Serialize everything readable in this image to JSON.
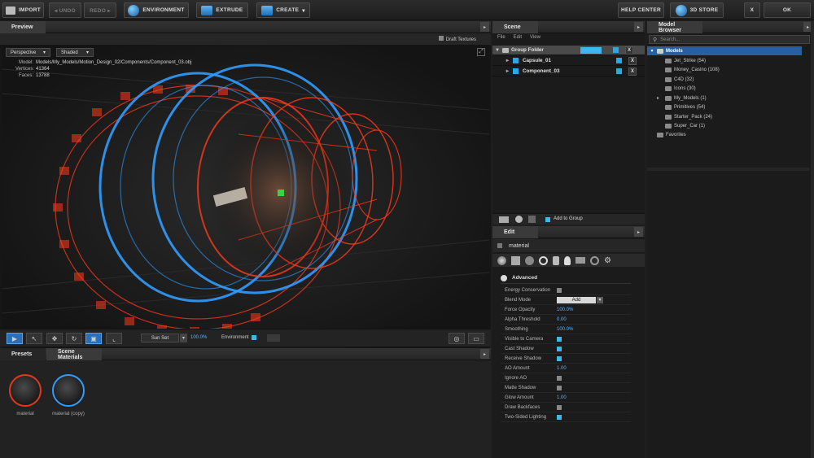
{
  "toolbar": {
    "import": "IMPORT",
    "undo": "◂ UNDO",
    "redo": "REDO ▸",
    "environment": "ENVIRONMENT",
    "extrude": "EXTRUDE",
    "create": "CREATE",
    "create_caret": "▾",
    "help_center": "HELP CENTER",
    "store": "3D STORE",
    "close": "X",
    "ok": "OK"
  },
  "preview": {
    "tab": "Preview",
    "draft_textures": "Draft Textures",
    "camera_mode": "Perspective",
    "render_mode": "Shaded",
    "model_label": "Model:",
    "model_value": "Models/My_Models/Motion_Design_02/Components/Component_03.obj",
    "vertices_label": "Vertices:",
    "vertices_value": "41364",
    "faces_label": "Faces:",
    "faces_value": "13788"
  },
  "viewport_toolbar": {
    "sun_set": "Sun Set",
    "sun_value": "100.0%",
    "environment": "Environment"
  },
  "presets": {
    "tabs": [
      "Presets",
      "Scene Materials"
    ],
    "materials": [
      "material",
      "material (copy)"
    ]
  },
  "scene": {
    "tab": "Scene",
    "menu": [
      "File",
      "Edit",
      "View"
    ],
    "group_folder": "Group Folder",
    "items": [
      "Capsule_01",
      "Component_03"
    ],
    "add_to_group": "Add to Group",
    "close": "X"
  },
  "edit": {
    "tab": "Edit",
    "material_name": "material",
    "section": "Advanced",
    "props": [
      {
        "label": "Energy Conservation",
        "type": "check",
        "on": false
      },
      {
        "label": "Blend Mode",
        "type": "select",
        "value": "Add"
      },
      {
        "label": "Force Opacity",
        "type": "value",
        "value": "100.0%"
      },
      {
        "label": "Alpha Threshold",
        "type": "value",
        "value": "0.00"
      },
      {
        "label": "Smoothing",
        "type": "value",
        "value": "100.0%"
      },
      {
        "label": "Visible to Camera",
        "type": "check",
        "on": true
      },
      {
        "label": "Cast Shadow",
        "type": "check",
        "on": true
      },
      {
        "label": "Receive Shadow",
        "type": "check",
        "on": true
      },
      {
        "label": "AO Amount",
        "type": "value",
        "value": "1.00"
      },
      {
        "label": "Ignore AO",
        "type": "check",
        "on": false
      },
      {
        "label": "Matte Shadow",
        "type": "check",
        "on": false
      },
      {
        "label": "Glow Amount",
        "type": "value",
        "value": "1.00"
      },
      {
        "label": "Draw Backfaces",
        "type": "check",
        "on": false
      },
      {
        "label": "Two-Sided Lighting",
        "type": "check",
        "on": true
      }
    ]
  },
  "browser": {
    "tab": "Model Browser",
    "search_placeholder": "Search...",
    "root": "Models",
    "folders": [
      "Jet_Strike (54)",
      "Money_Casino (108)",
      "C4D (32)",
      "Icons (30)",
      "My_Models (1)",
      "Primitives (54)",
      "Starter_Pack (24)",
      "Super_Car (1)"
    ],
    "favorites": "Favorites"
  },
  "colors": {
    "accent": "#2a8fd8",
    "wire_red": "#ff3a1a",
    "wire_blue": "#2f9cff"
  }
}
